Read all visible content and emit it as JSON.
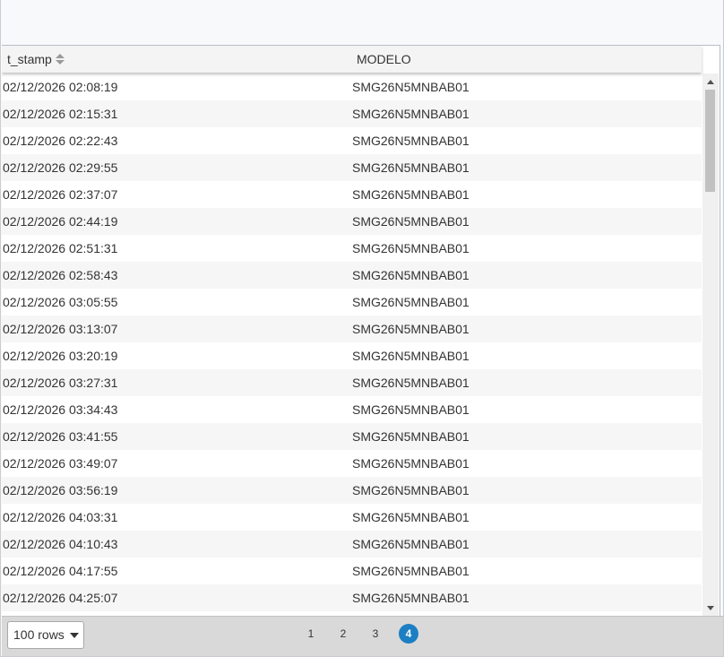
{
  "table": {
    "columns": [
      "t_stamp",
      "MODELO"
    ],
    "rows": [
      [
        "02/12/2026 02:08:19",
        "SMG26N5MNBAB01"
      ],
      [
        "02/12/2026 02:15:31",
        "SMG26N5MNBAB01"
      ],
      [
        "02/12/2026 02:22:43",
        "SMG26N5MNBAB01"
      ],
      [
        "02/12/2026 02:29:55",
        "SMG26N5MNBAB01"
      ],
      [
        "02/12/2026 02:37:07",
        "SMG26N5MNBAB01"
      ],
      [
        "02/12/2026 02:44:19",
        "SMG26N5MNBAB01"
      ],
      [
        "02/12/2026 02:51:31",
        "SMG26N5MNBAB01"
      ],
      [
        "02/12/2026 02:58:43",
        "SMG26N5MNBAB01"
      ],
      [
        "02/12/2026 03:05:55",
        "SMG26N5MNBAB01"
      ],
      [
        "02/12/2026 03:13:07",
        "SMG26N5MNBAB01"
      ],
      [
        "02/12/2026 03:20:19",
        "SMG26N5MNBAB01"
      ],
      [
        "02/12/2026 03:27:31",
        "SMG26N5MNBAB01"
      ],
      [
        "02/12/2026 03:34:43",
        "SMG26N5MNBAB01"
      ],
      [
        "02/12/2026 03:41:55",
        "SMG26N5MNBAB01"
      ],
      [
        "02/12/2026 03:49:07",
        "SMG26N5MNBAB01"
      ],
      [
        "02/12/2026 03:56:19",
        "SMG26N5MNBAB01"
      ],
      [
        "02/12/2026 04:03:31",
        "SMG26N5MNBAB01"
      ],
      [
        "02/12/2026 04:10:43",
        "SMG26N5MNBAB01"
      ],
      [
        "02/12/2026 04:17:55",
        "SMG26N5MNBAB01"
      ],
      [
        "02/12/2026 04:25:07",
        "SMG26N5MNBAB01"
      ]
    ]
  },
  "footer": {
    "rows_per_page": "100 rows",
    "pages": [
      "1",
      "2",
      "3",
      "4"
    ],
    "active_page": "4"
  },
  "colors": {
    "accent": "#1c7fc4",
    "header_bg": "#f4f4f4",
    "row_alt_bg": "#f6f6f6",
    "footer_bg": "#d9d9d9"
  },
  "icons": {
    "sort": "sort-icon",
    "dropdown": "chevron-down-icon"
  }
}
